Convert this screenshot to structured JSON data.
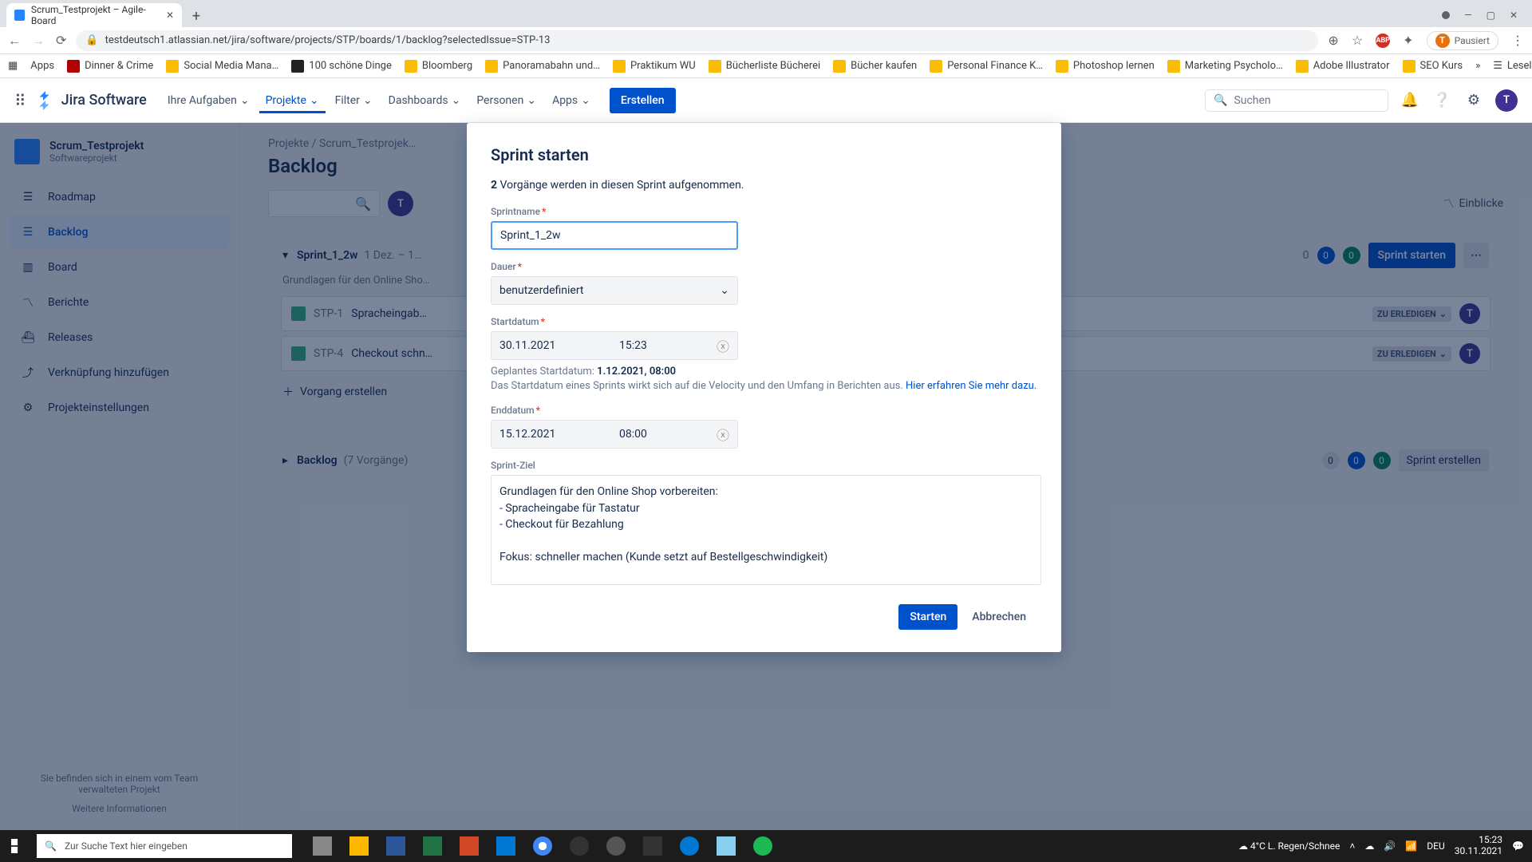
{
  "browser": {
    "tab_title": "Scrum_Testprojekt – Agile-Board",
    "url": "testdeutsch1.atlassian.net/jira/software/projects/STP/boards/1/backlog?selectedIssue=STP-13",
    "paused_label": "Pausiert",
    "bookmarks": [
      "Apps",
      "Dinner & Crime",
      "Social Media Mana…",
      "100 schöne Dinge",
      "Bloomberg",
      "Panoramabahn und…",
      "Praktikum WU",
      "Bücherliste Bücherei",
      "Bücher kaufen",
      "Personal Finance K…",
      "Photoshop lernen",
      "Marketing Psycholo…",
      "Adobe Illustrator",
      "SEO Kurs"
    ],
    "reading_list": "Leseliste"
  },
  "nav": {
    "product": "Jira Software",
    "items": [
      "Ihre Aufgaben",
      "Projekte",
      "Filter",
      "Dashboards",
      "Personen",
      "Apps"
    ],
    "active_index": 1,
    "create": "Erstellen",
    "search_placeholder": "Suchen",
    "avatar_initial": "T"
  },
  "sidebar": {
    "project_name": "Scrum_Testprojekt",
    "project_type": "Softwareprojekt",
    "links": [
      {
        "label": "Roadmap"
      },
      {
        "label": "Backlog"
      },
      {
        "label": "Board"
      },
      {
        "label": "Berichte"
      },
      {
        "label": "Releases"
      },
      {
        "label": "Verknüpfung hinzufügen"
      },
      {
        "label": "Projekteinstellungen"
      }
    ],
    "active_index": 1,
    "footer_line": "Sie befinden sich in einem vom Team verwalteten Projekt",
    "footer_link": "Weitere Informationen"
  },
  "main": {
    "breadcrumb": "Projekte  /  Scrum_Testprojek…",
    "title": "Backlog",
    "einblicke": "Einblicke",
    "avatar_initial": "T",
    "sprint": {
      "name": "Sprint_1_2w",
      "date": "1 Dez. – 1…",
      "subtitle": "Grundlagen für den Online Sho…",
      "counts": {
        "todo": "0",
        "inprog": "0",
        "done": "0"
      },
      "start_btn": "Sprint starten",
      "issues": [
        {
          "key": "STP-1",
          "summary": "Spracheingab…",
          "status": "ZU ERLEDIGEN"
        },
        {
          "key": "STP-4",
          "summary": "Checkout schn…",
          "status": "ZU ERLEDIGEN"
        }
      ],
      "create_item": "Vorgang erstellen"
    },
    "backlog_section": {
      "name": "Backlog",
      "count": "(7 Vorgänge)",
      "counts": {
        "todo": "0",
        "inprog": "0",
        "done": "0"
      },
      "create_btn": "Sprint erstellen"
    }
  },
  "modal": {
    "title": "Sprint starten",
    "intro_count": "2",
    "intro_rest": " Vorgänge werden in diesen Sprint aufgenommen.",
    "labels": {
      "sprint_name": "Sprintname",
      "duration": "Dauer",
      "start_date": "Startdatum",
      "end_date": "Enddatum",
      "goal": "Sprint-Ziel"
    },
    "values": {
      "sprint_name": "Sprint_1_2w",
      "duration": "benutzerdefiniert",
      "start_date": "30.11.2021",
      "start_time": "15:23",
      "end_date": "15.12.2021",
      "end_time": "08:00",
      "goal": "Grundlagen für den Online Shop vorbereiten:\n- Spracheingabe für Tastatur\n- Checkout für Bezahlung\n\nFokus: schneller machen (Kunde setzt auf Bestellgeschwindigkeit)"
    },
    "hint": {
      "prefix": "Geplantes Startdatum: ",
      "date": "1.12.2021, 08:00",
      "line2a": "Das Startdatum eines Sprints wirkt sich auf die Velocity und den Umfang in Berichten aus. ",
      "link": "Hier erfahren Sie mehr dazu."
    },
    "actions": {
      "start": "Starten",
      "cancel": "Abbrechen"
    }
  },
  "taskbar": {
    "search_placeholder": "Zur Suche Text hier eingeben",
    "weather": "4°C  L. Regen/Schnee",
    "lang": "DEU",
    "time": "15:23",
    "date": "30.11.2021"
  }
}
